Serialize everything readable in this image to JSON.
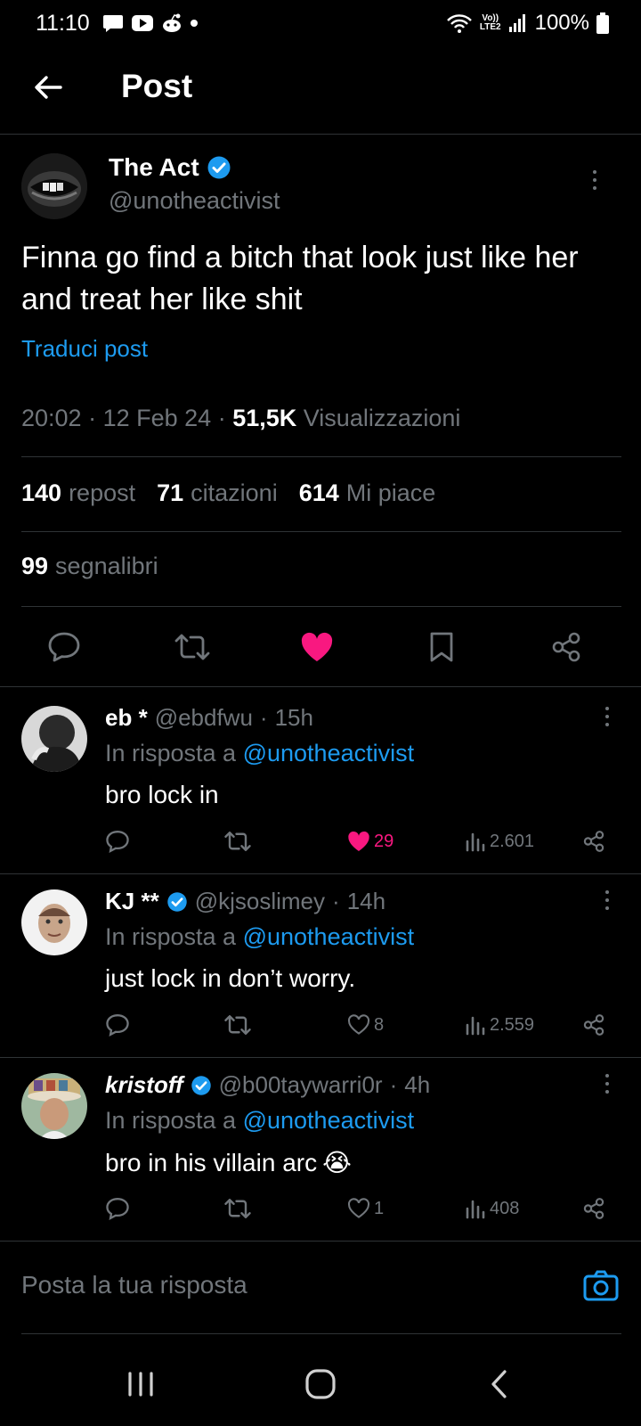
{
  "status_bar": {
    "time": "11:10",
    "network_top": "Vo))",
    "network_bottom": "LTE2",
    "battery": "100%"
  },
  "header": {
    "title": "Post"
  },
  "post": {
    "author_name": "The Act",
    "author_handle": "@unotheactivist",
    "verified": true,
    "text": "Finna go find a bitch that look just like her and treat her like shit",
    "translate_label": "Traduci post",
    "time": "20:02",
    "date": "12 Feb 24",
    "views_count": "51,5K",
    "views_label": "Visualizzazioni",
    "reposts_count": "140",
    "reposts_label": "repost",
    "quotes_count": "71",
    "quotes_label": "citazioni",
    "likes_count": "614",
    "likes_label": "Mi piace",
    "bookmarks_count": "99",
    "bookmarks_label": "segnalibri",
    "liked": true
  },
  "replies": [
    {
      "name": "eb *",
      "verified": false,
      "handle": "@ebdfwu",
      "age": "15h",
      "reply_prefix": "In risposta a",
      "reply_to": "@unotheactivist",
      "text": "bro lock in",
      "emoji": "",
      "likes": "29",
      "liked": true,
      "views": "2.601"
    },
    {
      "name": "KJ **",
      "verified": true,
      "handle": "@kjsoslimey",
      "age": "14h",
      "reply_prefix": "In risposta a",
      "reply_to": "@unotheactivist",
      "text": "just lock in don’t worry.",
      "emoji": "",
      "likes": "8",
      "liked": false,
      "views": "2.559"
    },
    {
      "name": "kristoff",
      "verified": true,
      "handle": "@b00taywarri0r",
      "age": "4h",
      "reply_prefix": "In risposta a",
      "reply_to": "@unotheactivist",
      "text": "bro in his villain arc",
      "emoji": "😭",
      "likes": "1",
      "liked": false,
      "views": "408"
    }
  ],
  "compose": {
    "placeholder": "Posta la tua risposta"
  },
  "colors": {
    "accent": "#1d9bf0",
    "like": "#f91880",
    "muted": "#71767b",
    "divider": "#2f3336",
    "background": "#000000"
  }
}
